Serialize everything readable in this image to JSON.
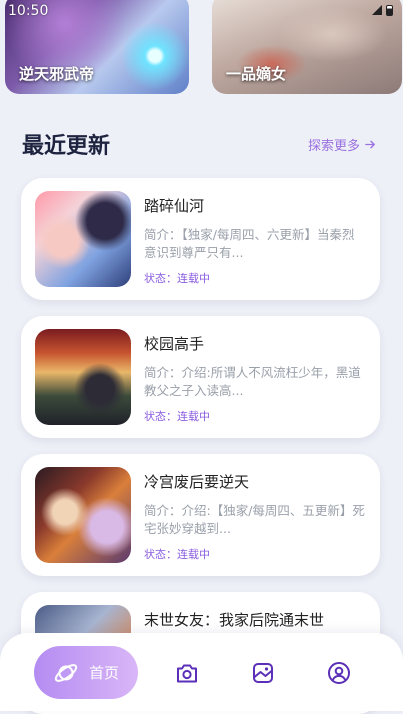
{
  "status_bar": {
    "time": "10:50"
  },
  "banners": [
    {
      "title": "逆天邪武帝"
    },
    {
      "title": "一品嫡女"
    }
  ],
  "section": {
    "title": "最近更新",
    "explore_label": "探索更多"
  },
  "updates": [
    {
      "title": "踏碎仙河",
      "desc": "简介：【独家/每周四、六更新】当秦烈意识到尊严只有...",
      "status": "状态：连载中"
    },
    {
      "title": "校园高手",
      "desc": "简介：介绍:所谓人不风流枉少年，黑道教父之子入读高...",
      "status": "状态：连载中"
    },
    {
      "title": "冷宫废后要逆天",
      "desc": "简介：介绍:【独家/每周四、五更新】死宅张妙穿越到...",
      "status": "状态：连载中"
    },
    {
      "title": "末世女友：我家后院通末世",
      "desc": "",
      "status": ""
    }
  ],
  "tabbar": {
    "home_label": "首页",
    "tabs": [
      "planet-icon",
      "camera-icon",
      "gallery-icon",
      "user-icon"
    ]
  },
  "colors": {
    "accent": "#9a6fe0",
    "status": "#8a5ce0",
    "background": "#eef0f8"
  }
}
